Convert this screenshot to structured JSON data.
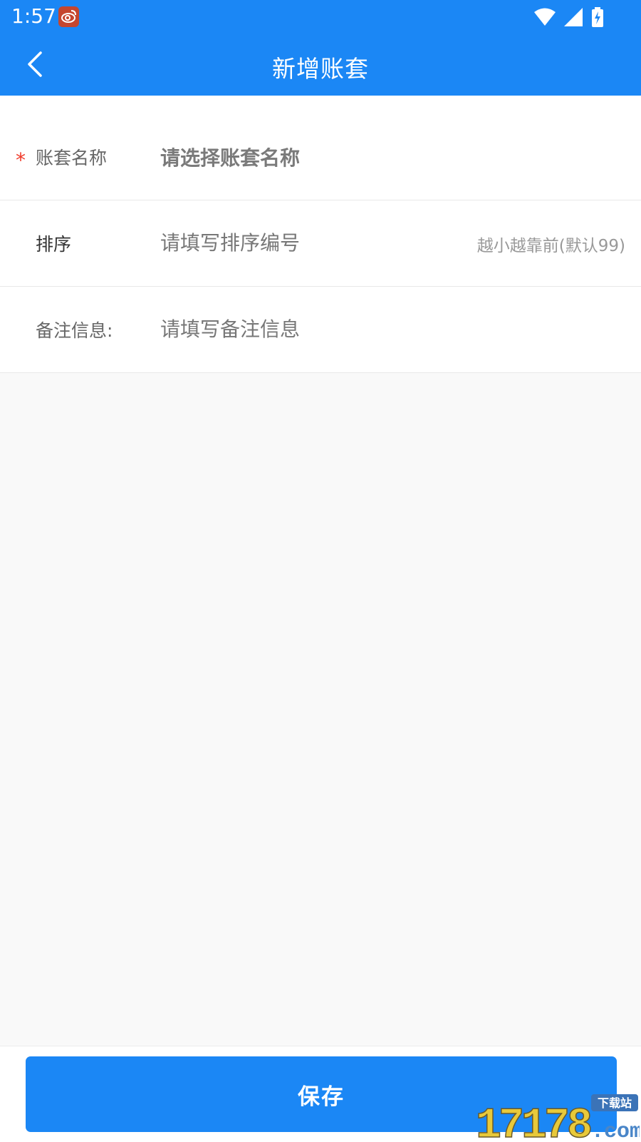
{
  "status_bar": {
    "time": "1:57",
    "app_icon": "weibo-icon",
    "icons": [
      "wifi-icon",
      "cellular-signal-icon",
      "battery-charging-icon"
    ]
  },
  "header": {
    "title": "新增账套",
    "back_icon": "chevron-left-icon"
  },
  "form": {
    "account_name": {
      "required_mark": "*",
      "label": "账套名称",
      "placeholder": "请选择账套名称"
    },
    "sort": {
      "label": "排序",
      "placeholder": "请填写排序编号",
      "hint": "越小越靠前(默认99)"
    },
    "remark": {
      "label": "备注信息:",
      "placeholder": "请填写备注信息"
    }
  },
  "footer": {
    "save_label": "保存"
  },
  "watermark": {
    "brand": "17178",
    "suffix": ".com",
    "tag": "下载站"
  },
  "colors": {
    "primary": "#1b87f5",
    "required": "#f03c2c",
    "background": "#f9f9f9"
  }
}
